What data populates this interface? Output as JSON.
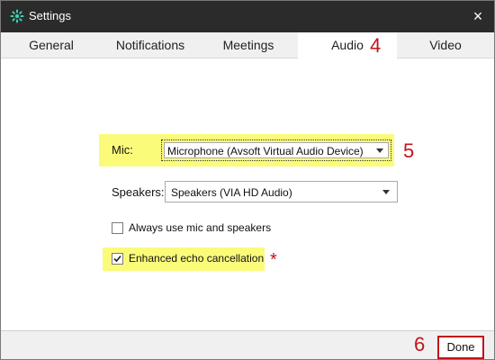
{
  "window": {
    "title": "Settings",
    "close_symbol": "×"
  },
  "tabs": [
    {
      "label": "General",
      "active": false
    },
    {
      "label": "Notifications",
      "active": false
    },
    {
      "label": "Meetings",
      "active": false
    },
    {
      "label": "Audio",
      "active": true
    },
    {
      "label": "Video",
      "active": false
    }
  ],
  "annotations": {
    "tab_step": "4",
    "mic_step": "5",
    "done_step": "6",
    "echo_star": "*"
  },
  "audio": {
    "mic_label": "Mic:",
    "mic_value": "Microphone (Avsoft Virtual Audio Device)",
    "speakers_label": "Speakers:",
    "speakers_value": "Speakers (VIA HD Audio)",
    "always_use_label": "Always use mic and speakers",
    "always_use_checked": false,
    "echo_label": "Enhanced echo cancellation",
    "echo_checked": true
  },
  "footer": {
    "done_label": "Done"
  },
  "colors": {
    "titlebar": "#2b2b2b",
    "highlight": "#fbfb7a",
    "annotation_red": "#c0151b",
    "app_icon": "#3ecfb0"
  },
  "icons": {
    "app": "gear-icon",
    "close": "close-icon",
    "dropdown": "chevron-down-icon",
    "check": "check-icon"
  }
}
